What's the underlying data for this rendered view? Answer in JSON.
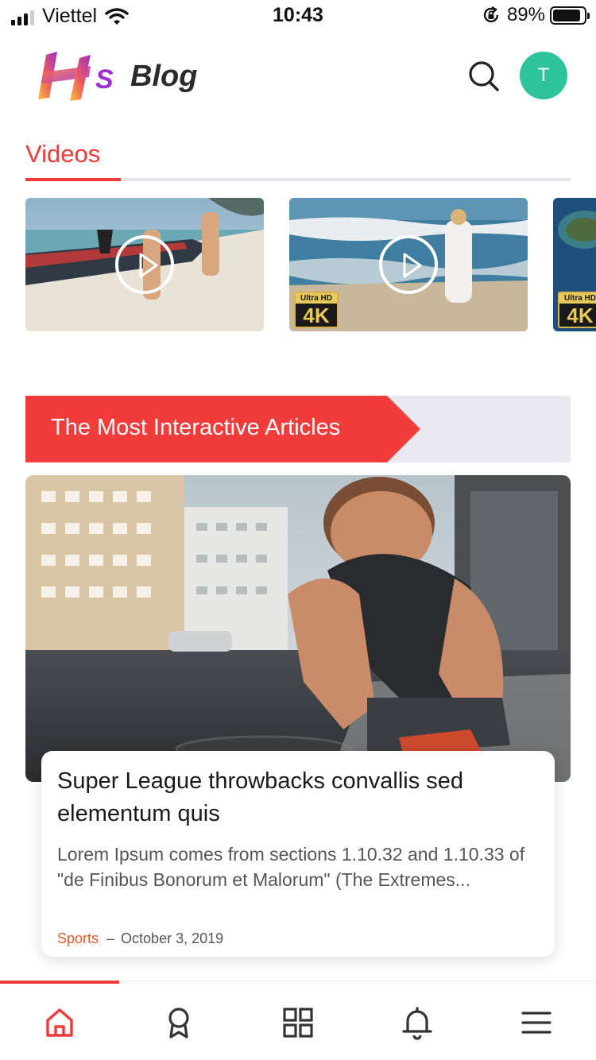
{
  "status_bar": {
    "carrier": "Viettel",
    "time": "10:43",
    "battery_percent": "89%",
    "battery_level": 0.89
  },
  "header": {
    "logo_text": "Blog",
    "logo_letters": "HS",
    "avatar_initial": "T",
    "icons": {
      "search": "search-icon"
    },
    "colors": {
      "avatar": "#2ec39a",
      "accent": "#f03a3a"
    }
  },
  "videos": {
    "title": "Videos",
    "items": [
      {
        "thumbnail": "beach-boat-walk",
        "badge": null
      },
      {
        "thumbnail": "woman-at-shore",
        "badge": {
          "top": "Ultra HD",
          "main": "4K"
        }
      },
      {
        "thumbnail": "aerial-island",
        "badge": {
          "top": "Ultra HD",
          "main": "4K"
        }
      }
    ]
  },
  "section": {
    "title": "The Most Interactive Articles"
  },
  "article": {
    "image": "runner-tying-shoe",
    "title": "Super League throwbacks convallis sed elementum quis",
    "excerpt": "Lorem Ipsum comes from sections 1.10.32 and 1.10.33 of \"de Finibus Bonorum et Malorum\" (The Extremes...",
    "category": "Sports",
    "separator": "–",
    "date": "October 3, 2019"
  },
  "bottom_nav": {
    "active": "home",
    "items": [
      {
        "id": "home",
        "icon": "home-icon"
      },
      {
        "id": "awards",
        "icon": "award-icon"
      },
      {
        "id": "categories",
        "icon": "grid-icon"
      },
      {
        "id": "notifications",
        "icon": "bell-icon"
      },
      {
        "id": "menu",
        "icon": "menu-icon"
      }
    ]
  }
}
